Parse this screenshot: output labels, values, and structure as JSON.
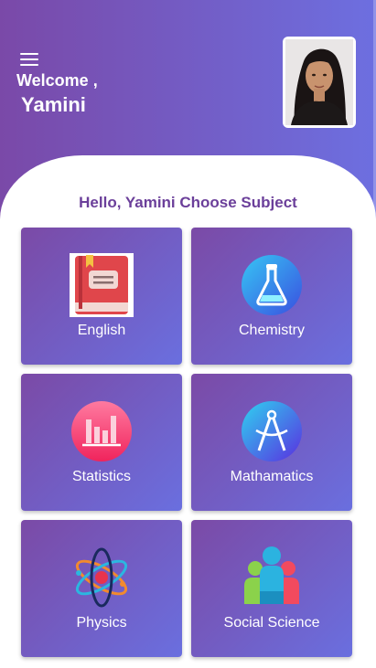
{
  "header": {
    "welcome": "Welcome ,",
    "user_name": "Yamini",
    "menu_icon": "hamburger-menu-icon",
    "avatar_icon": "profile-photo"
  },
  "prompt": "Hello, Yamini Choose Subject",
  "subjects": [
    {
      "label": "English",
      "icon": "book-icon"
    },
    {
      "label": "Chemistry",
      "icon": "flask-icon"
    },
    {
      "label": "Statistics",
      "icon": "bar-chart-icon"
    },
    {
      "label": "Mathamatics",
      "icon": "compass-icon"
    },
    {
      "label": "Physics",
      "icon": "atom-icon"
    },
    {
      "label": "Social Science",
      "icon": "people-icon"
    }
  ],
  "colors": {
    "header_start": "#7a49a8",
    "header_end": "#6d6fe0",
    "prompt_text": "#6b3f9a",
    "tile_start": "#7b4aa6",
    "tile_end": "#6a6fdf"
  }
}
